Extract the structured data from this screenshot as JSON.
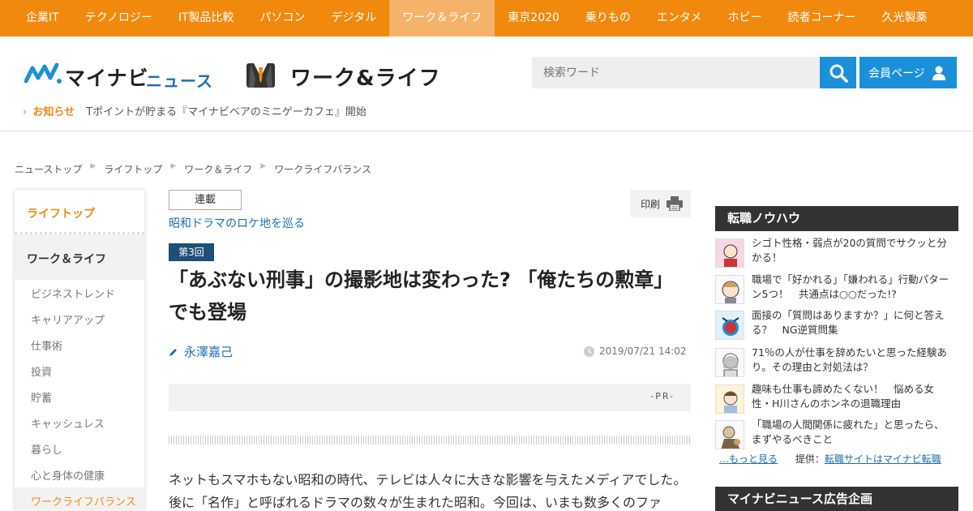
{
  "topnav": {
    "items": [
      "企業IT",
      "テクノロジー",
      "IT製品比較",
      "パソコン",
      "デジタル",
      "ワーク＆ライフ",
      "東京2020",
      "乗りもの",
      "エンタメ",
      "ホビー",
      "読者コーナー",
      "久光製薬"
    ],
    "active_index": 5
  },
  "header": {
    "brand": "マイナビ",
    "brand_sub": "ニュース",
    "section_logo": "ワーク&ライフ",
    "search_placeholder": "検索ワード",
    "member_label": "会員ページ",
    "notice_label": "お知らせ",
    "notice_text": "Tポイントが貯まる『マイナビベアのミニゲーカフェ』開始"
  },
  "breadcrumb": [
    "ニューストップ",
    "ライフトップ",
    "ワーク＆ライフ",
    "ワークライフバランス"
  ],
  "sidebar": {
    "top_label": "ライフトップ",
    "category": "ワーク＆ライフ",
    "items": [
      "ビジネストレンド",
      "キャリアアップ",
      "仕事術",
      "投資",
      "貯蓄",
      "キャッシュレス",
      "暮らし",
      "心と身体の健康",
      "ワークライフバランス"
    ],
    "active_index": 8
  },
  "article": {
    "series_badge": "連載",
    "series_title": "昭和ドラマのロケ地を巡る",
    "print_label": "印刷",
    "episode": "第3回",
    "headline": "「あぶない刑事」の撮影地は変わった? 「俺たちの勲章」でも登場",
    "author": "永澤嘉己",
    "date": "2019/07/21 14:02",
    "pr_label": "-PR-",
    "body": "ネットもスマホもない昭和の時代、テレビは人々に大きな影響を与えたメディアでした。後に「名作」と呼ばれるドラマの数々が生まれた昭和。今回は、いまも数多くのファ"
  },
  "right_sidebar": {
    "heading": "転職ノウハウ",
    "items": [
      "シゴト性格・弱点が20の質問でサクッと分かる！",
      "職場で「好かれる」「嫌われる」行動パターン5つ！　共通点は○○だった!?",
      "面接の「質問はありますか？」に何と答える？　NG逆質問集",
      "71％の人が仕事を辞めたいと思った経験あり。その理由と対処法は？",
      "趣味も仕事も諦めたくない！　悩める女性・H川さんのホンネの退職理由",
      "「職場の人間関係に疲れた」と思ったら、まずやるべきこと"
    ],
    "more_label": "…もっと見る",
    "provided_by": "提供：",
    "provider_link": "転職サイトはマイナビ転職",
    "heading2": "マイナビニュース広告企画"
  },
  "colors": {
    "nav_orange": "#f0890e",
    "nav_active": "#f5b26a",
    "link_blue": "#1a6fb4",
    "button_blue": "#1b90d8",
    "episode_navy": "#1f4e79",
    "sidebar_dark": "#333333"
  }
}
